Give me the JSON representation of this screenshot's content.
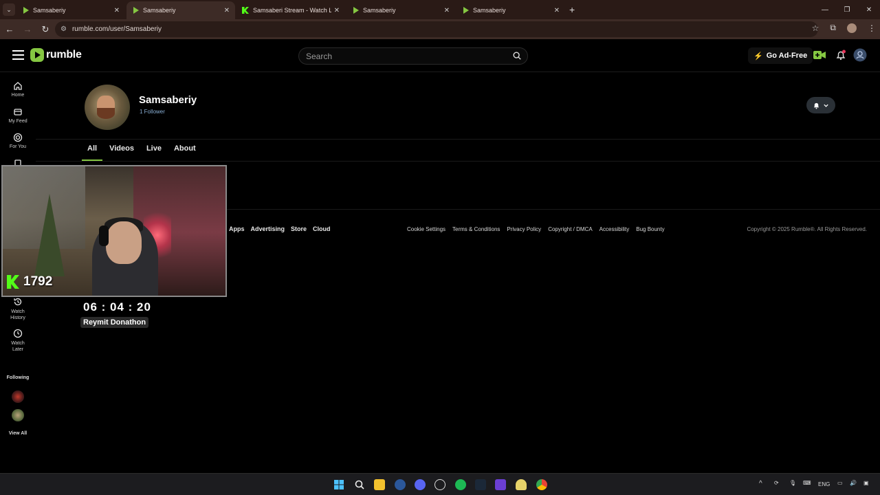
{
  "browser": {
    "tabs": [
      {
        "title": "Samsaberiy",
        "favicon": "rumble-favicon"
      },
      {
        "title": "Samsaberiy",
        "favicon": "rumble-favicon",
        "active": true
      },
      {
        "title": "Samsaberi Stream - Watch Live",
        "favicon": "kick-favicon"
      },
      {
        "title": "Samsaberiy",
        "favicon": "rumble-favicon"
      },
      {
        "title": "Samsaberiy",
        "favicon": "rumble-favicon"
      }
    ],
    "url": "rumble.com/user/Samsaberiy"
  },
  "header": {
    "logo_text": "rumble",
    "search_placeholder": "Search",
    "go_ad_free": "Go Ad-Free"
  },
  "sidebar": {
    "items": [
      {
        "label": "Home",
        "icon": "home-icon"
      },
      {
        "label": "My Feed",
        "icon": "feed-icon"
      },
      {
        "label": "For You",
        "icon": "target-icon"
      },
      {
        "label": "Watch History",
        "icon": "history-icon"
      },
      {
        "label": "Watch Later",
        "icon": "clock-icon"
      }
    ],
    "following_label": "Following",
    "view_all": "View All"
  },
  "channel": {
    "name": "Samsaberiy",
    "followers": "1 Follower",
    "tabs": [
      "All",
      "Videos",
      "Live",
      "About"
    ],
    "active_tab": "All"
  },
  "footer": {
    "links": [
      "Apps",
      "Advertising",
      "Store",
      "Cloud"
    ],
    "legal": [
      "Cookie Settings",
      "Terms & Conditions",
      "Privacy Policy",
      "Copyright / DMCA",
      "Accessibility",
      "Bug Bounty"
    ],
    "copyright": "Copyright © 2025 Rumble®. All Rights Reserved."
  },
  "overlay": {
    "kick_count": "1792",
    "timer": "06 : 04 : 20",
    "event": "Reymit Donathon"
  },
  "taskbar": {
    "language": "ENG"
  },
  "colors": {
    "rumble_green": "#85c742",
    "kick_green": "#53fc18",
    "follower_blue": "#8ab0d6"
  }
}
